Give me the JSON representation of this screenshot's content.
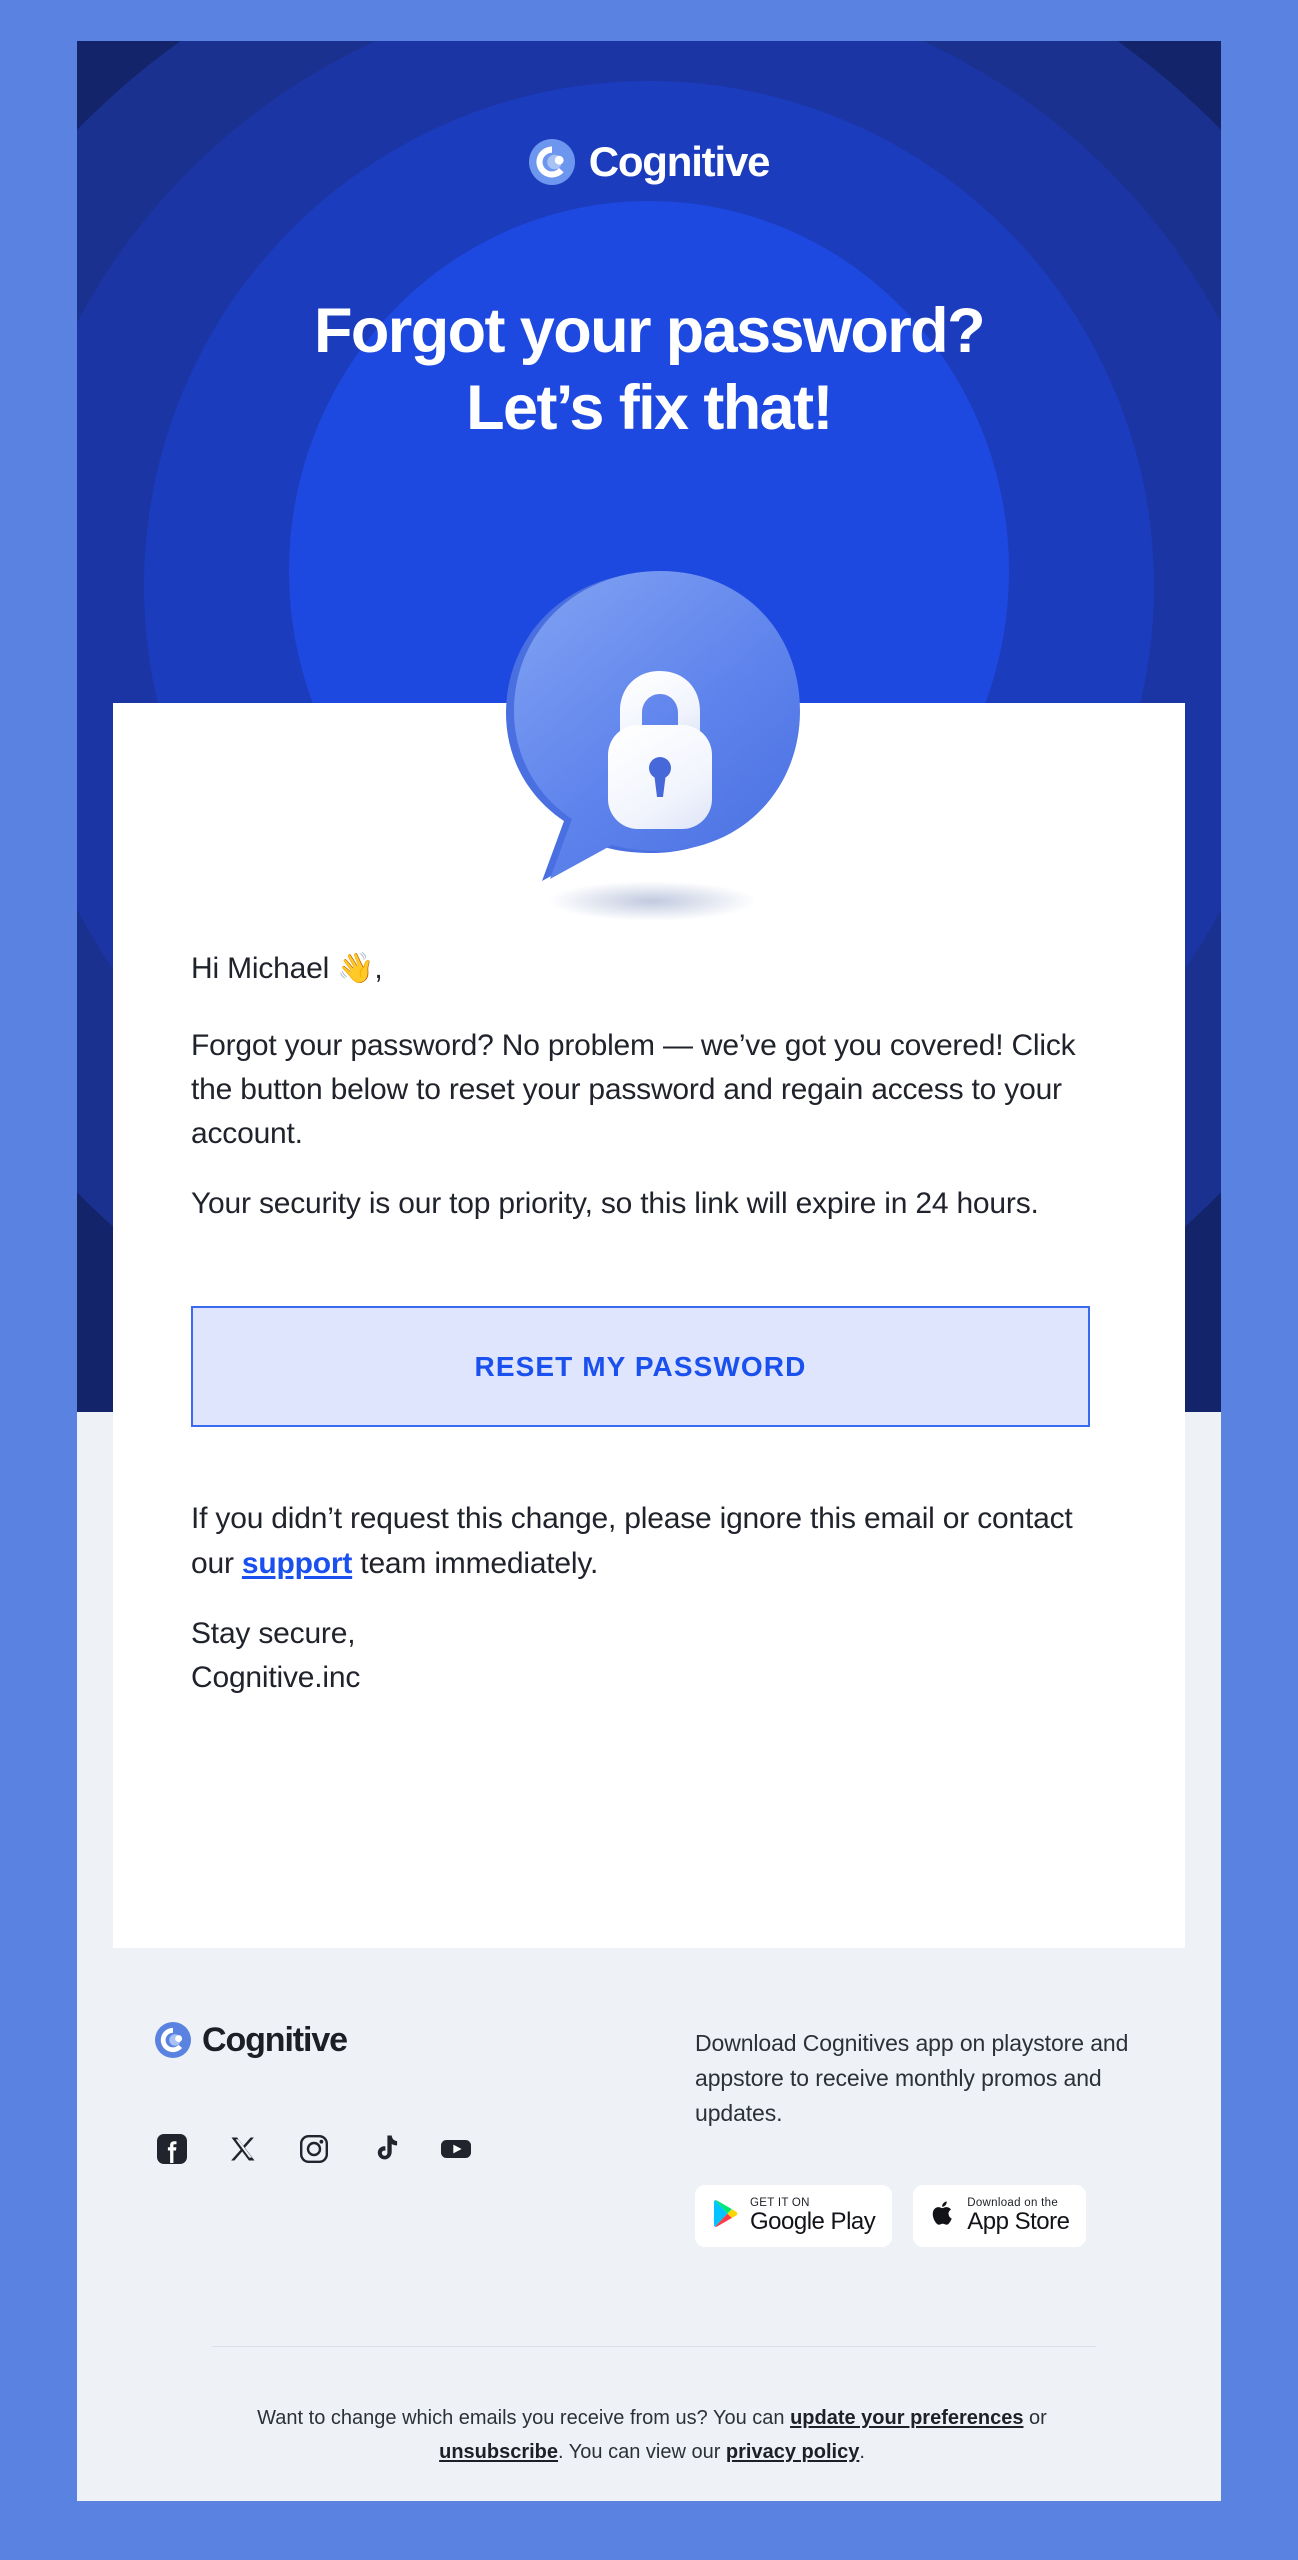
{
  "brand": {
    "name": "Cognitive",
    "accent": "#1a50ee",
    "hero_bg": "#13246b",
    "page_bg": "#5a82e0",
    "footer_bg": "#eef1f6"
  },
  "hero": {
    "logo_text": "Cognitive",
    "headline_line1": "Forgot your password?",
    "headline_line2": "Let’s fix that!",
    "illustration_name": "lock-speech-bubble-illustration"
  },
  "body": {
    "greeting": "Hi Michael 👋,",
    "paragraph_1": "Forgot your password? No problem — we’ve got you covered! Click the button below to reset your password and regain access to your account.",
    "paragraph_2": "Your security is our top priority, so this link will expire in 24 hours.",
    "cta_label": "RESET MY PASSWORD",
    "notice_before": "If you didn’t request this change, please ignore this email or contact our ",
    "notice_link": "support",
    "notice_after": " team immediately.",
    "signoff_line1": "Stay secure,",
    "signoff_line2": "Cognitive.inc"
  },
  "footer": {
    "logo_text": "Cognitive",
    "description": "Download Cognitives app on playstore and appstore to receive monthly promos and updates.",
    "socials": [
      {
        "name": "facebook-icon",
        "label": "Facebook"
      },
      {
        "name": "x-twitter-icon",
        "label": "X"
      },
      {
        "name": "instagram-icon",
        "label": "Instagram"
      },
      {
        "name": "tiktok-icon",
        "label": "TikTok"
      },
      {
        "name": "youtube-icon",
        "label": "YouTube"
      }
    ],
    "badges": [
      {
        "small": "GET IT ON",
        "large": "Google Play",
        "icon": "google-play-icon"
      },
      {
        "small": "Download on the",
        "large": "App Store",
        "icon": "apple-icon"
      }
    ],
    "legal_1": "Want to change which emails you receive from us? You can ",
    "legal_link_1": "update your preferences",
    "legal_2": " or ",
    "legal_link_2": "unsubscribe",
    "legal_3": ". You can view our ",
    "legal_link_3": "privacy policy",
    "legal_4": "."
  }
}
